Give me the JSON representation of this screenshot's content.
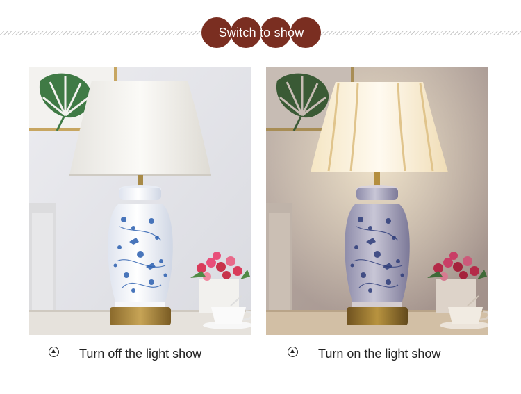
{
  "header": {
    "title": "Switch to show"
  },
  "photos": {
    "off": {
      "alt": "Blue and white porcelain table lamp with white shade, light off"
    },
    "on": {
      "alt": "Blue and white porcelain table lamp with glowing shade, light on"
    }
  },
  "captions": {
    "off": {
      "text": "Turn off the light show",
      "icon": "play-up-circle-icon"
    },
    "on": {
      "text": "Turn on the light show",
      "icon": "play-up-circle-icon"
    }
  },
  "colors": {
    "title_bg": "#7a2e21",
    "title_text": "#ffffff",
    "caption_text": "#222222",
    "hatch": "#c9c9c9"
  }
}
